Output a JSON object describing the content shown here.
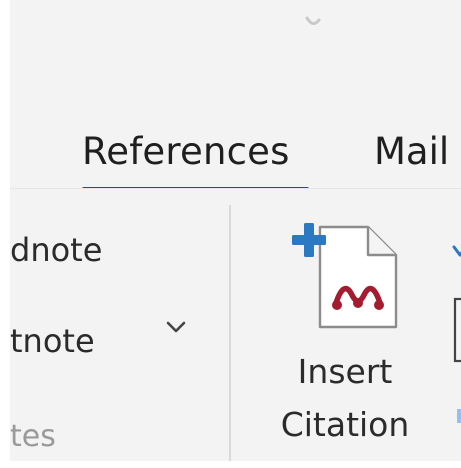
{
  "ribbon": {
    "tabs": [
      {
        "label": "References",
        "active": true
      },
      {
        "label": "Mail",
        "active": false
      }
    ],
    "footnotes_group": {
      "insert_endnote_label": "dnote",
      "next_footnote_label": "tnote",
      "group_label": "tes"
    },
    "citation_group": {
      "insert_citation_line1": "Insert",
      "insert_citation_line2": "Citation"
    }
  },
  "colors": {
    "accent_underline": "#1e4e8c",
    "plus_icon": "#2b79c2",
    "mendeley_logo": "#a51c30"
  },
  "icons": {
    "insert_citation": "document-plus-mendeley-icon",
    "dropdown": "chevron-down-icon"
  }
}
